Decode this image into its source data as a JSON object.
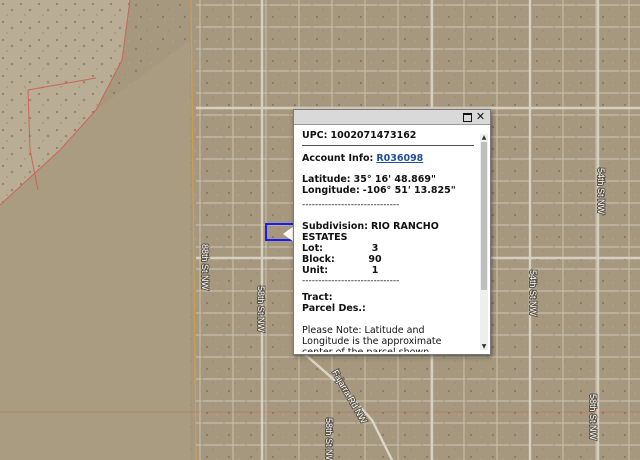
{
  "map": {
    "colors": {
      "terrain": "#a6987e",
      "terrain_light": "#b9ad95",
      "parcel_line": "#d6cfbf",
      "road": "#dcd6c8",
      "boundary_red": "#d4574f",
      "highway_orange": "#e0a23a",
      "selected_parcel": "#1a1aff"
    },
    "street_labels": [
      {
        "id": "label-left-street",
        "text": "88th St NW"
      },
      {
        "id": "label-58th",
        "text": "58th St NW"
      },
      {
        "id": "label-right-top",
        "text": "54th St NW"
      },
      {
        "id": "label-right-mid",
        "text": "54th St NW"
      },
      {
        "id": "label-bottom-center",
        "text": "58th St NW"
      },
      {
        "id": "label-fajarra",
        "text": "Fajarra Rd NW"
      },
      {
        "id": "label-bottom-right",
        "text": "58th St NW"
      }
    ]
  },
  "popup": {
    "upc_label": "UPC:",
    "upc_value": "1002071473162",
    "account_label": "Account Info:",
    "account_value": "R036098",
    "latitude_label": "Latitude:",
    "latitude_value": "35° 16' 48.869\"",
    "longitude_label": "Longitude:",
    "longitude_value": "-106° 51' 13.825\"",
    "dashes": "------------------------------",
    "subdivision_label": "Subdivision:",
    "subdivision_value": "RIO RANCHO ESTATES",
    "lot_label": "Lot:",
    "lot_value": "3",
    "block_label": "Block:",
    "block_value": "90",
    "unit_label": "Unit:",
    "unit_value": "1",
    "tract_label": "Tract:",
    "parcel_des_label": "Parcel Des.:",
    "note": "Please Note: Latitude and Longitude is the approximate center of the parcel shown."
  }
}
